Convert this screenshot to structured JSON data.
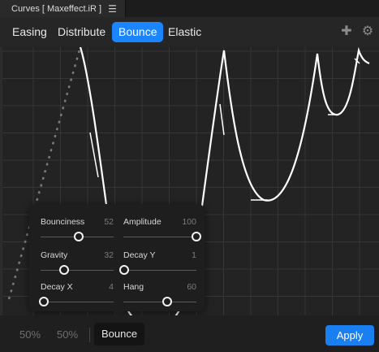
{
  "window": {
    "title": "Curves [ Maxeffect.iR ]",
    "menu_icon": "hamburger-icon"
  },
  "tabs": [
    {
      "label": "Easing",
      "active": false
    },
    {
      "label": "Distribute",
      "active": false
    },
    {
      "label": "Bounce",
      "active": true
    },
    {
      "label": "Elastic",
      "active": false
    }
  ],
  "tools": {
    "add_icon": "plus-icon",
    "settings_icon": "gear-icon"
  },
  "popup": {
    "sliders": [
      {
        "label": "Bounciness",
        "value": "52",
        "fraction": 0.52
      },
      {
        "label": "Amplitude",
        "value": "100",
        "fraction": 1.0
      },
      {
        "label": "Gravity",
        "value": "32",
        "fraction": 0.32
      },
      {
        "label": "Decay Y",
        "value": "1",
        "fraction": 0.01
      },
      {
        "label": "Decay X",
        "value": "4",
        "fraction": 0.04
      },
      {
        "label": "Hang",
        "value": "60",
        "fraction": 0.6
      }
    ]
  },
  "bottom": {
    "zoom_x": "50%",
    "zoom_y": "50%",
    "preset": "Bounce",
    "apply_label": "Apply"
  },
  "colors": {
    "accent": "#1a85ff",
    "apply": "#1a7ff0",
    "curve": "#ffffff"
  }
}
